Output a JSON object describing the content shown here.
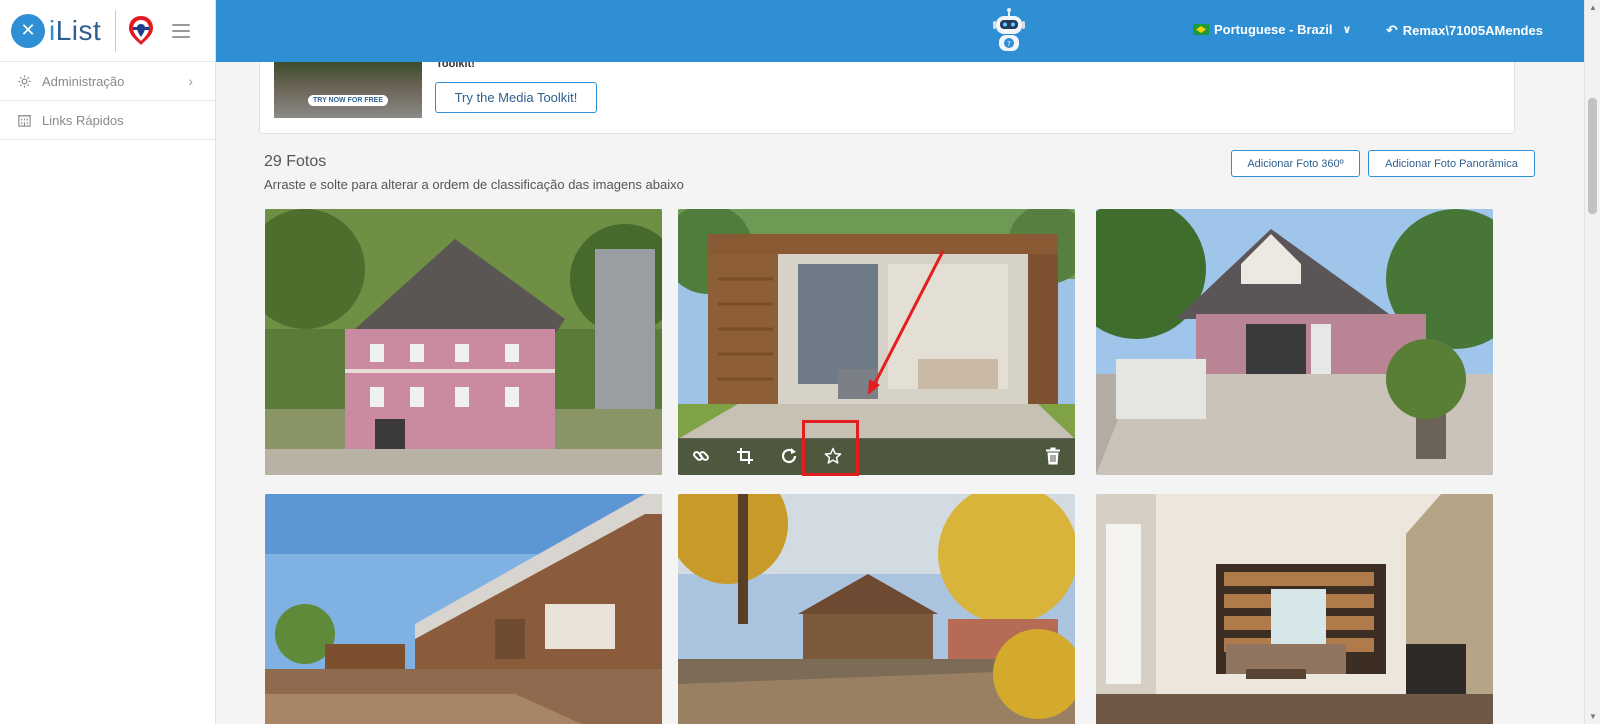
{
  "app": {
    "logo_mark": "✕",
    "logo_text_i": "i",
    "logo_text_rest": "List"
  },
  "sidebar": {
    "items": [
      {
        "label": "Administração",
        "icon": "gear-icon"
      },
      {
        "label": "Links Rápidos",
        "icon": "building-icon"
      }
    ]
  },
  "topbar": {
    "language": "Portuguese - Brazil",
    "user": "Remax\\71005AMendes"
  },
  "media_toolkit": {
    "title_cut": "Toolkit!",
    "badge": "TRY NOW FOR FREE",
    "button": "Try the Media Toolkit!"
  },
  "photos": {
    "title": "29 Fotos",
    "subtitle": "Arraste e solte para alterar a ordem de classificação das imagens abaixo",
    "add_360": "Adicionar Foto 360º",
    "add_panoramic": "Adicionar Foto Panorâmica"
  },
  "tile_tools": [
    "link-icon",
    "crop-icon",
    "rotate-icon",
    "star-icon",
    "trash-icon"
  ],
  "colors": {
    "primary": "#2f8fd4",
    "highlight": "#e41e1e",
    "sidebar_text": "#8a8a8a"
  }
}
